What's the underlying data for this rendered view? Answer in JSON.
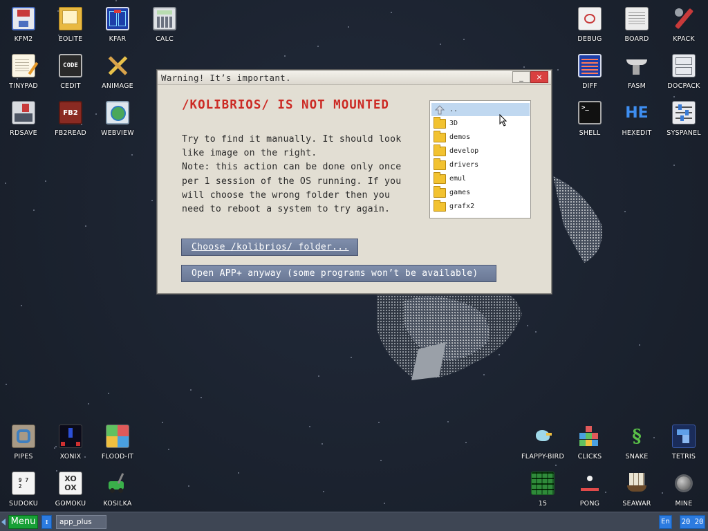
{
  "desktop": {
    "icons": {
      "kfm2": {
        "label": "KFM2",
        "icon": "floppy-disk-icon"
      },
      "eolite": {
        "label": "EOLITE",
        "icon": "folder-icon"
      },
      "kfar": {
        "label": "KFAR",
        "icon": "blue-panels-icon"
      },
      "calc": {
        "label": "CALC",
        "icon": "calculator-icon"
      },
      "tinypad": {
        "label": "TINYPAD",
        "icon": "notepad-icon"
      },
      "cedit": {
        "label": "CEDIT",
        "icon": "code-icon"
      },
      "animage": {
        "label": "ANIMAGE",
        "icon": "paint-tools-icon"
      },
      "rdsave": {
        "label": "RDSAVE",
        "icon": "save-disk-icon"
      },
      "fb2read": {
        "label": "FB2READ",
        "icon": "book-icon"
      },
      "webview": {
        "label": "WEBVIEW",
        "icon": "globe-window-icon"
      },
      "debug": {
        "label": "DEBUG",
        "icon": "bug-icon"
      },
      "board": {
        "label": "BOARD",
        "icon": "clipboard-icon"
      },
      "kpack": {
        "label": "KPACK",
        "icon": "wrench-icon"
      },
      "diff": {
        "label": "DIFF",
        "icon": "diff-grid-icon"
      },
      "fasm": {
        "label": "FASM",
        "icon": "anvil-icon"
      },
      "docpack": {
        "label": "DOCPACK",
        "icon": "cabinet-icon"
      },
      "shell": {
        "label": "SHELL",
        "icon": "terminal-icon"
      },
      "hexedit": {
        "label": "HEXEDIT",
        "icon": "hex-editor-icon",
        "text": "HE"
      },
      "syspanel": {
        "label": "SYSPANEL",
        "icon": "sliders-icon"
      },
      "pipes": {
        "label": "PIPES",
        "icon": "pipes-icon"
      },
      "xonix": {
        "label": "XONIX",
        "icon": "xonix-icon"
      },
      "flood_it": {
        "label": "FLOOD-IT",
        "icon": "color-grid-icon"
      },
      "sudoku": {
        "label": "SUDOKU",
        "icon": "sudoku-grid-icon"
      },
      "gomoku": {
        "label": "GOMOKU",
        "icon": "gomoku-board-icon"
      },
      "kosilka": {
        "label": "KOSILKA",
        "icon": "lawnmower-icon"
      },
      "flappy_bird": {
        "label": "FLAPPY-BIRD",
        "icon": "bird-icon"
      },
      "clicks": {
        "label": "CLICKS",
        "icon": "blocks-icon"
      },
      "snake": {
        "label": "SNAKE",
        "icon": "snake-icon"
      },
      "tetris": {
        "label": "TETRIS",
        "icon": "tetris-icon"
      },
      "fifteen": {
        "label": "15",
        "icon": "fifteen-puzzle-icon"
      },
      "pong": {
        "label": "PONG",
        "icon": "pong-icon"
      },
      "seawar": {
        "label": "SEAWAR",
        "icon": "ship-icon"
      },
      "mine": {
        "label": "MINE",
        "icon": "mine-icon"
      }
    }
  },
  "dialog": {
    "title": "Warning! It’s important.",
    "minimize": "_",
    "close": "×",
    "headline": "/KOLIBRIOS/ IS NOT MOUNTED",
    "message_lines": [
      "Try to find it manually. It should look",
      "like image on the right.",
      "Note: this action can be done only once",
      "per 1 session of the OS running. If you",
      "will choose the wrong folder then you",
      "need to reboot a system to try again."
    ],
    "choose_button": "Choose /kolibrios/ folder...",
    "open_button": "Open APP+ anyway (some programs won’t be available)",
    "file_list": {
      "up": "..",
      "folders": [
        "3D",
        "demos",
        "develop",
        "drivers",
        "emul",
        "games",
        "grafx2"
      ]
    }
  },
  "taskbar": {
    "menu": "Menu",
    "swap": "↕",
    "task": "app_plus",
    "lang": "En",
    "clock": "20 20"
  },
  "colors": {
    "accent_red": "#cc2a24",
    "button_blue": "#6a7895",
    "menu_green": "#17a036",
    "taskbar_blue": "#2c7be0"
  }
}
